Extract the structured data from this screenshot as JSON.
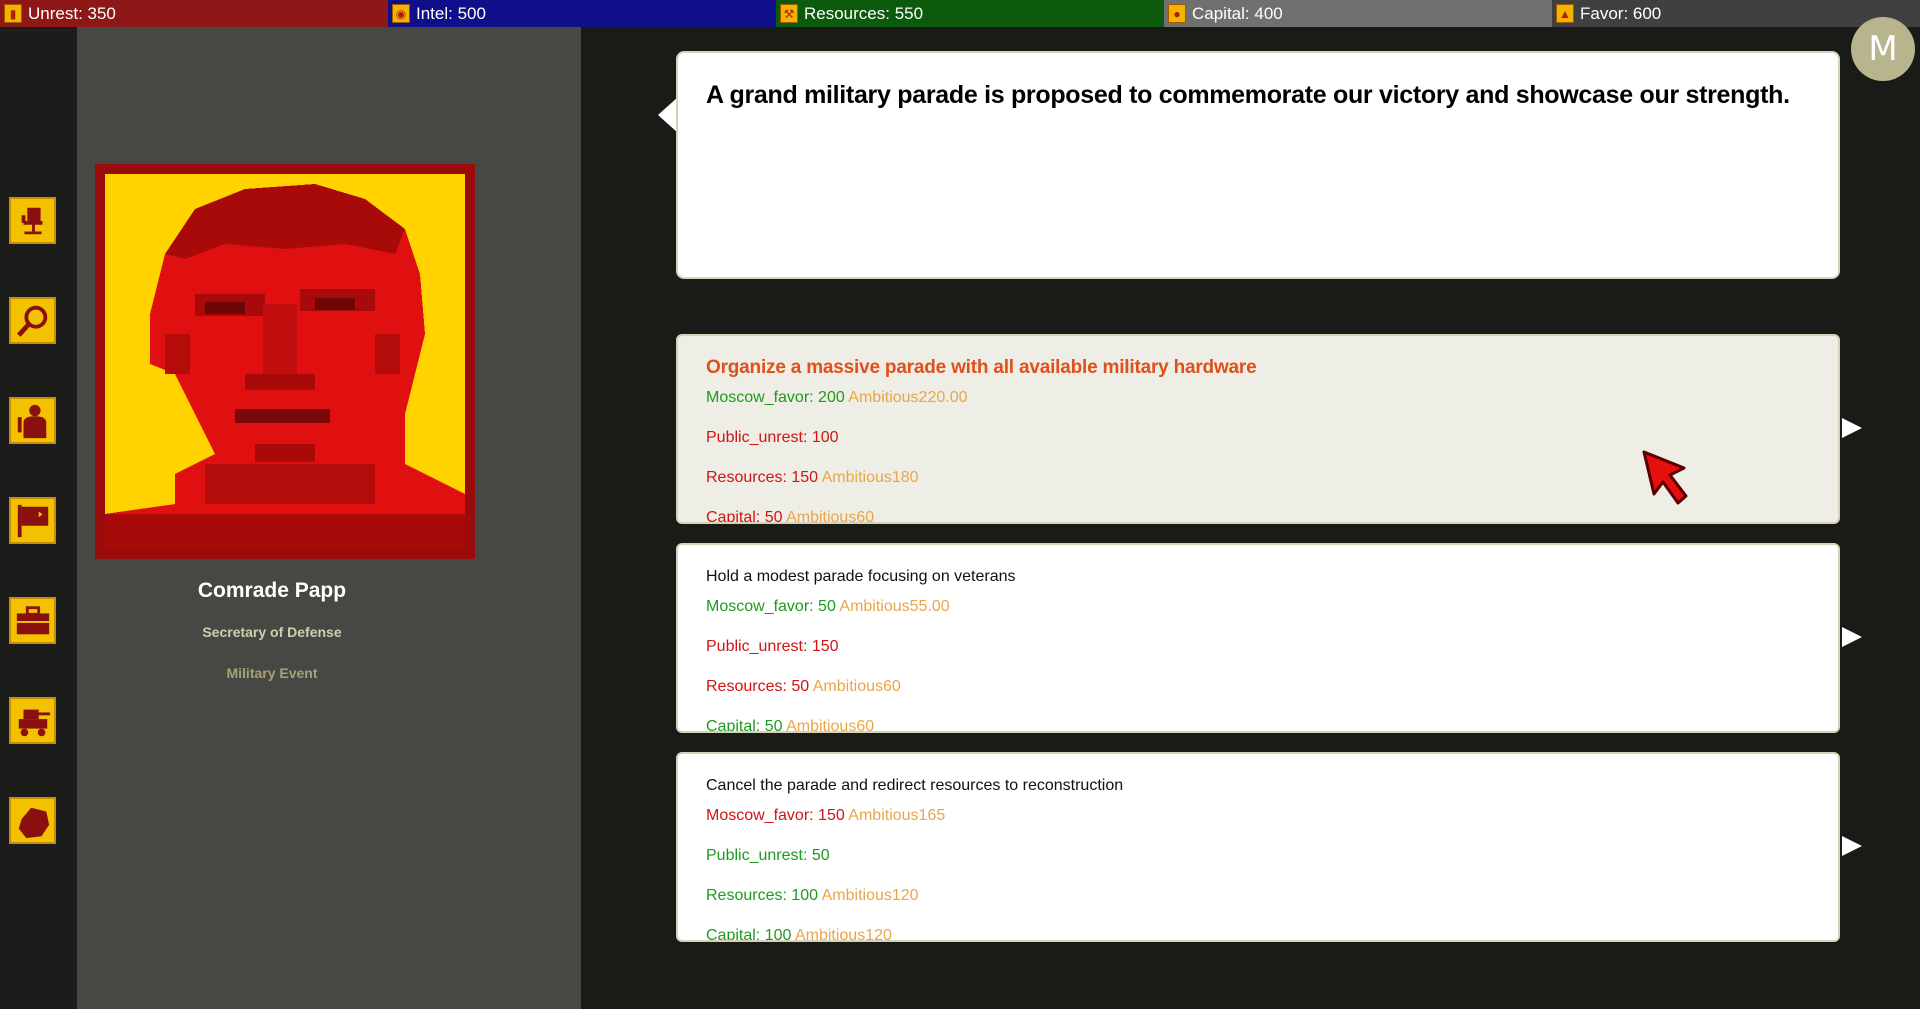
{
  "topbar": {
    "unrest": "Unrest: 350",
    "intel": "Intel: 500",
    "resources": "Resources: 550",
    "capital": "Capital: 400",
    "favor": "Favor: 600"
  },
  "menu_button": "M",
  "rail_icons": [
    "office-chair-icon",
    "magnifier-icon",
    "soldier-icon",
    "flag-icon",
    "briefcase-icon",
    "tank-icon",
    "map-region-icon"
  ],
  "character": {
    "name": "Comrade Papp",
    "title": "Secretary of Defense",
    "event_type": "Military Event"
  },
  "event_text": "A grand military parade is proposed to commemorate our victory and showcase our strength.",
  "choices": [
    {
      "title": "Organize a massive parade with all available military hardware",
      "effects": [
        {
          "label": "Moscow_favor: 200",
          "ambitious": "Ambitious220.00",
          "tone": "pos"
        },
        {
          "label": "Public_unrest: 100",
          "ambitious": "",
          "tone": "neg"
        },
        {
          "label": "Resources: 150",
          "ambitious": "Ambitious180",
          "tone": "neg"
        },
        {
          "label": "Capital: 50",
          "ambitious": "Ambitious60",
          "tone": "neg"
        }
      ]
    },
    {
      "title": "Hold a modest parade focusing on veterans",
      "effects": [
        {
          "label": "Moscow_favor: 50",
          "ambitious": "Ambitious55.00",
          "tone": "pos"
        },
        {
          "label": "Public_unrest: 150",
          "ambitious": "",
          "tone": "neg"
        },
        {
          "label": "Resources: 50",
          "ambitious": "Ambitious60",
          "tone": "neg"
        },
        {
          "label": "Capital: 50",
          "ambitious": "Ambitious60",
          "tone": "pos"
        }
      ]
    },
    {
      "title": "Cancel the parade and redirect resources to reconstruction",
      "effects": [
        {
          "label": "Moscow_favor: 150",
          "ambitious": "Ambitious165",
          "tone": "neg"
        },
        {
          "label": "Public_unrest: 50",
          "ambitious": "",
          "tone": "pos"
        },
        {
          "label": "Resources: 100",
          "ambitious": "Ambitious120",
          "tone": "pos"
        },
        {
          "label": "Capital: 100",
          "ambitious": "Ambitious120",
          "tone": "pos"
        }
      ]
    }
  ],
  "colors": {
    "positive": "#1e9a1e",
    "negative": "#d11414",
    "ambitious": "#e8a64a",
    "selected_title": "#e0501a"
  }
}
